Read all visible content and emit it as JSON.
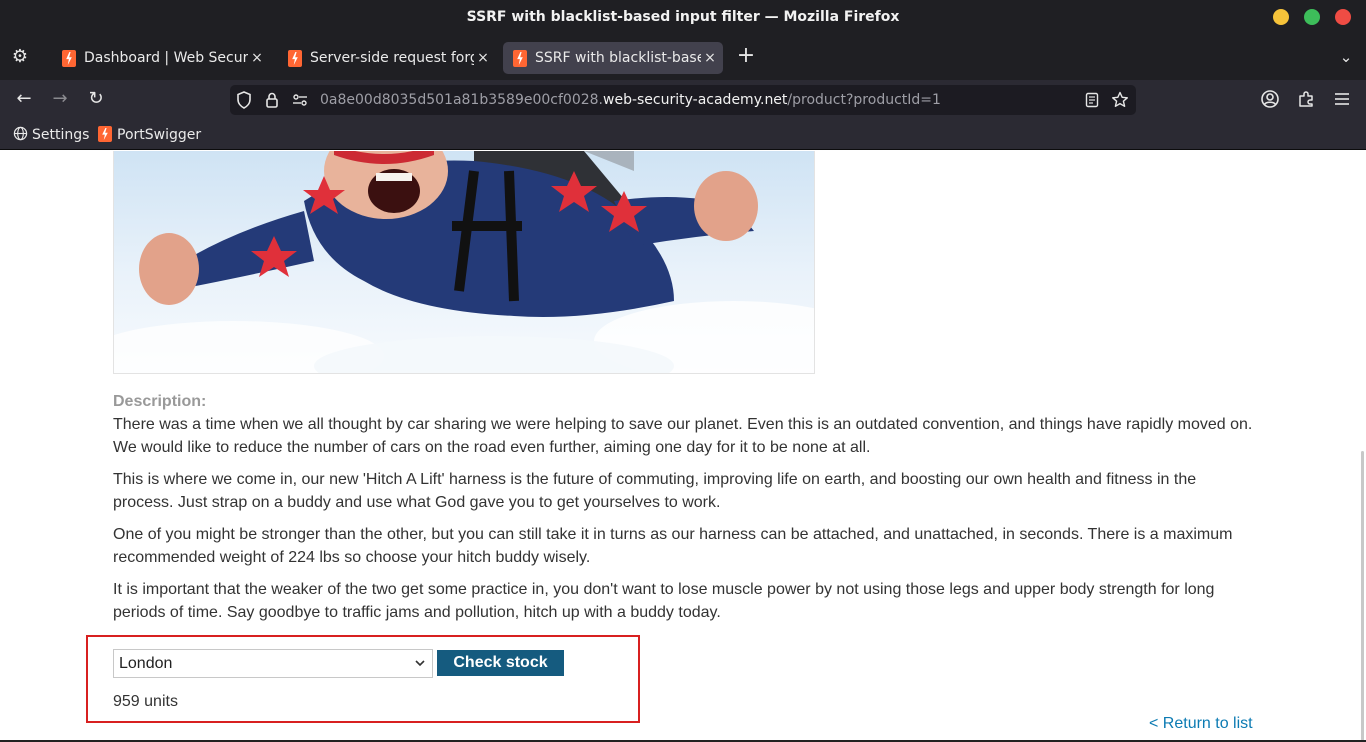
{
  "window": {
    "title": "SSRF with blacklist-based input filter — Mozilla Firefox"
  },
  "tabs": [
    {
      "label": "Dashboard | Web Security",
      "close": "×"
    },
    {
      "label": "Server-side request forge",
      "close": "×"
    },
    {
      "label": "SSRF with blacklist-based",
      "close": "×"
    }
  ],
  "tabbar": {
    "new_tab": "+",
    "list_all": "⌄",
    "settings": "⚙"
  },
  "navbar": {
    "back": "←",
    "forward": "→",
    "reload": "↻",
    "url_subdomain": "0a8e00d8035d501a81b3589e00cf0028.",
    "url_domain": "web-security-academy.net",
    "url_path": "/product?productId=1"
  },
  "bookmarks": [
    {
      "label": "Settings"
    },
    {
      "label": "PortSwigger"
    }
  ],
  "product": {
    "description_label": "Description:",
    "paragraphs": [
      "There was a time when we all thought by car sharing we were helping to save our planet. Even this is an outdated convention, and things have rapidly moved on. We would like to reduce the number of cars on the road even further, aiming one day for it to be none at all.",
      "This is where we come in, our new 'Hitch A Lift' harness is the future of commuting, improving life on earth, and boosting our own health and fitness in the process. Just strap on a buddy and use what God gave you to get yourselves to work.",
      "One of you might be stronger than the other, but you can still take it in turns as our harness can be attached, and unattached, in seconds. There is a maximum recommended weight of 224 lbs so choose your hitch buddy wisely.",
      "It is important that the weaker of the two get some practice in, you don't want to lose muscle power by not using those legs and upper body strength for long periods of time. Say goodbye to traffic jams and pollution, hitch up with a buddy today."
    ]
  },
  "stock": {
    "selected_store": "London",
    "button_label": "Check stock",
    "result": "959 units"
  },
  "return_link": "< Return to list",
  "colors": {
    "accent_button": "#155b7f",
    "link": "#0c7bb3",
    "highlight_box": "#d82020"
  }
}
